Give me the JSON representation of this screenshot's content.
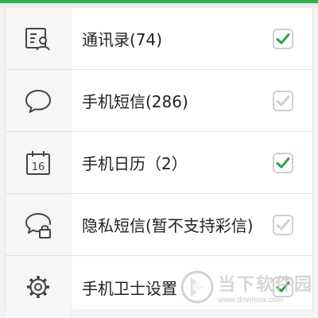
{
  "colors": {
    "accent": "#2fb14d",
    "check_active": "#2ea442",
    "check_disabled": "#d0d0d0",
    "icon_stroke": "#444444"
  },
  "items": [
    {
      "icon": "contacts-card-icon",
      "label": "通讯录(74)",
      "checked": true,
      "disabled": false
    },
    {
      "icon": "speech-bubble-icon",
      "label": "手机短信(286)",
      "checked": true,
      "disabled": true
    },
    {
      "icon": "calendar-icon",
      "calendar_day": "16",
      "label": "手机日历（2）",
      "checked": true,
      "disabled": false
    },
    {
      "icon": "private-message-lock-icon",
      "label": "隐私短信(暂不支持彩信)",
      "checked": true,
      "disabled": true
    },
    {
      "icon": "gear-icon",
      "label": "手机卫士设置",
      "checked": true,
      "disabled": false
    }
  ],
  "watermark": {
    "title": "当下软件园",
    "url": "www.downxia.com"
  }
}
